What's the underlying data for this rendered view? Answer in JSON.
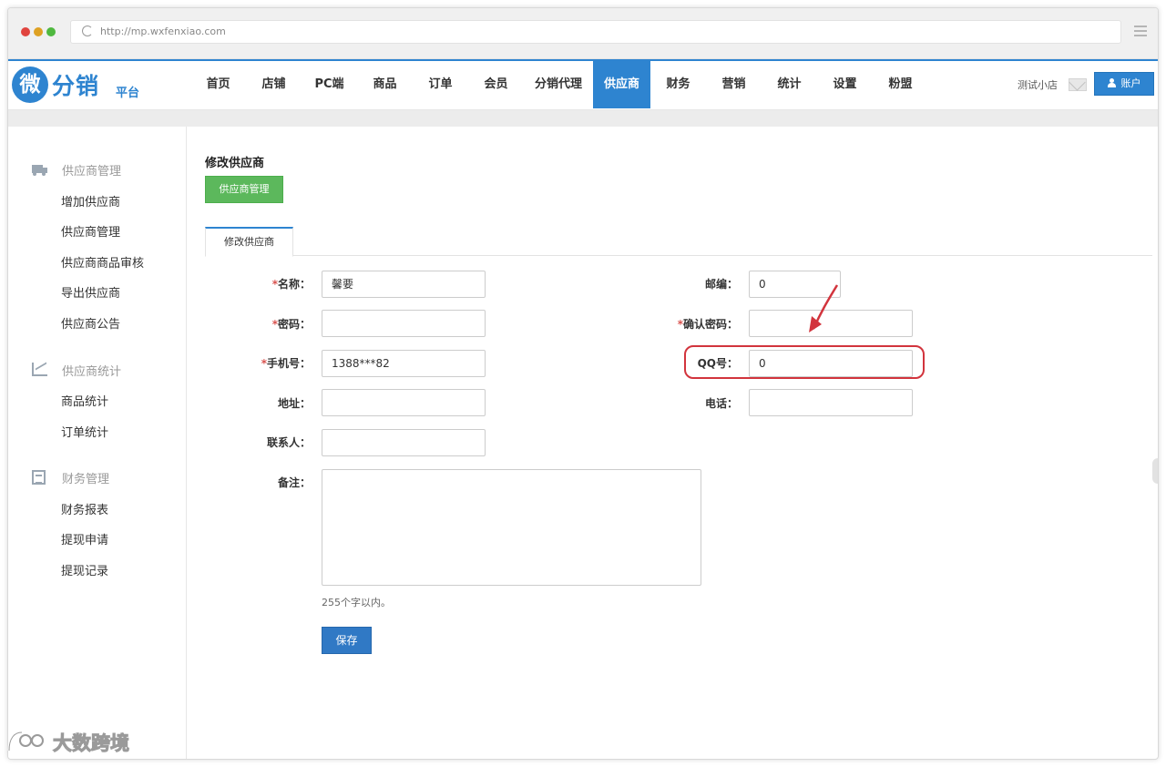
{
  "browser": {
    "url": "http://mp.wxfenxiao.com"
  },
  "logo": {
    "mark": "微",
    "name": "分销",
    "suffix": "平台"
  },
  "nav": {
    "items": [
      "首页",
      "店铺",
      "PC端",
      "商品",
      "订单",
      "会员",
      "分销代理",
      "供应商",
      "财务",
      "营销",
      "统计",
      "设置",
      "粉盟"
    ],
    "active": "供应商",
    "shop_name": "测试小店",
    "account_label": "账户"
  },
  "sidebar": {
    "groups": [
      {
        "label": "供应商管理",
        "icon": "truck-icon",
        "items": [
          "增加供应商",
          "供应商管理",
          "供应商商品审核",
          "导出供应商",
          "供应商公告"
        ]
      },
      {
        "label": "供应商统计",
        "icon": "chart-icon",
        "items": [
          "商品统计",
          "订单统计"
        ]
      },
      {
        "label": "财务管理",
        "icon": "ledger-icon",
        "items": [
          "财务报表",
          "提现申请",
          "提现记录"
        ]
      }
    ]
  },
  "main": {
    "title": "修改供应商",
    "manage_button": "供应商管理",
    "tab_label": "修改供应商",
    "required_mark": "*",
    "fields": {
      "name": {
        "label": "名称：",
        "value": "馨要",
        "required": true
      },
      "password": {
        "label": "密码：",
        "value": "",
        "required": true
      },
      "phone": {
        "label": "手机号：",
        "value": "1388***82",
        "required": true
      },
      "address": {
        "label": "地址：",
        "value": "",
        "required": false
      },
      "contact": {
        "label": "联系人：",
        "value": "",
        "required": false
      },
      "remark": {
        "label": "备注：",
        "value": "",
        "required": false
      },
      "zip": {
        "label": "邮编：",
        "value": "0",
        "required": false
      },
      "confirm_password": {
        "label": "确认密码：",
        "value": "",
        "required": true
      },
      "qq": {
        "label": "QQ号：",
        "value": "0",
        "required": false
      },
      "tel": {
        "label": "电话：",
        "value": "",
        "required": false
      }
    },
    "remark_hint": "255个字以内。",
    "save_label": "保存"
  },
  "annotation": {
    "highlight_color": "#d2343d"
  },
  "watermark": {
    "text": "大数跨境"
  },
  "colors": {
    "primary": "#2e84d0",
    "success": "#5cb85c",
    "save": "#3079c5",
    "required": "#d9534f"
  }
}
